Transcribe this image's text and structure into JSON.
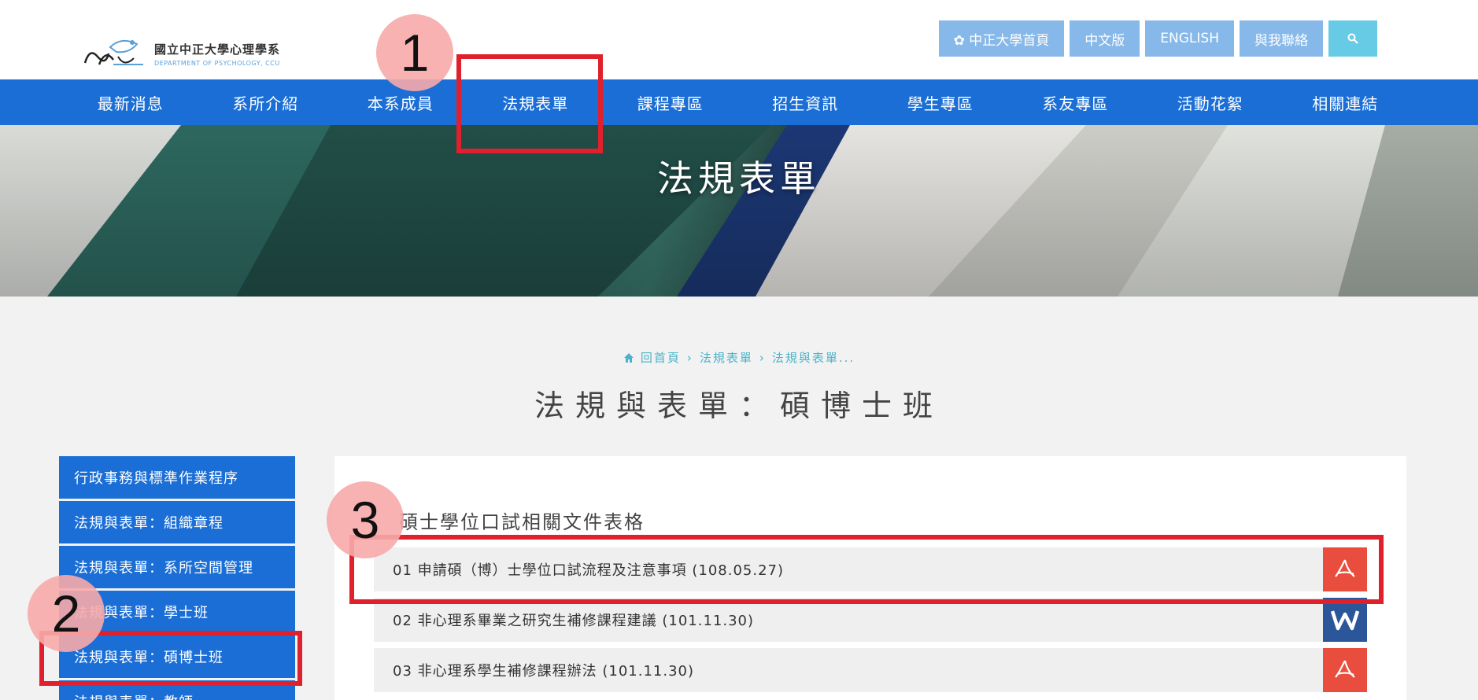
{
  "header": {
    "logo_zh": "國立中正大學心理學系",
    "logo_en": "DEPARTMENT OF PSYCHOLOGY, CCU",
    "top_links": [
      {
        "label": "✿ 中正大學首頁"
      },
      {
        "label": "中文版"
      },
      {
        "label": "ENGLISH"
      },
      {
        "label": "與我聯絡"
      }
    ]
  },
  "nav": {
    "items": [
      "最新消息",
      "系所介紹",
      "本系成員",
      "法規表單",
      "課程專區",
      "招生資訊",
      "學生專區",
      "系友專區",
      "活動花絮",
      "相關連結"
    ]
  },
  "banner": {
    "title": "法規表單"
  },
  "breadcrumb": {
    "home": "回首頁",
    "level1": "法規表單",
    "level2": "法規與表單..."
  },
  "page": {
    "title": "法規與表單：碩博士班"
  },
  "sidebar": {
    "items": [
      "行政事務與標準作業程序",
      "法規與表單：組織章程",
      "法規與表單：系所空間管理",
      "法規與表單：學士班",
      "法規與表單：碩博士班",
      "法規與表單：教師"
    ]
  },
  "content": {
    "section_title": "碩士學位口試相關文件表格",
    "files": [
      {
        "label": "01 申請碩（博）士學位口試流程及注意事項 (108.05.27)",
        "type": "pdf"
      },
      {
        "label": "02 非心理系畢業之研究生補修課程建議 (101.11.30)",
        "type": "word"
      },
      {
        "label": "03 非心理系學生補修課程辦法 (101.11.30)",
        "type": "pdf"
      }
    ]
  },
  "annotations": {
    "one": "1",
    "two": "2",
    "three": "3"
  },
  "colors": {
    "nav_blue": "#1a6ed6",
    "top_btn": "#86b8e9",
    "pdf_red": "#e84d3d",
    "word_blue": "#2b579a",
    "mark_red": "#e0202c"
  }
}
